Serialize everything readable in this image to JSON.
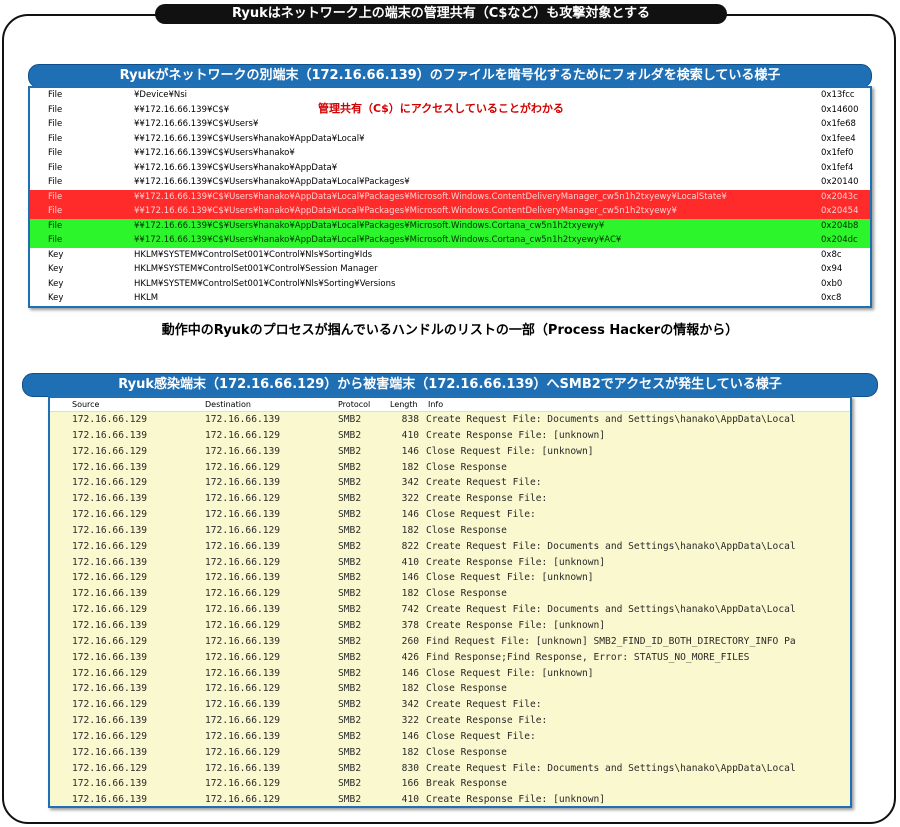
{
  "top_banner": "Ryukはネットワーク上の端末の管理共有（C$など）も攻撃対象とする",
  "section1_banner": "Ryukがネットワークの別端末（172.16.66.139）のファイルを暗号化するためにフォルダを検索している様子",
  "handle_note": "管理共有（C$）にアクセスしていることがわかる",
  "handles": [
    {
      "type": "File",
      "name": "¥Device¥Nsi",
      "handle": "0x13fcc",
      "highlight": ""
    },
    {
      "type": "File",
      "name": "¥¥172.16.66.139¥C$¥",
      "handle": "0x14600",
      "highlight": ""
    },
    {
      "type": "File",
      "name": "¥¥172.16.66.139¥C$¥Users¥",
      "handle": "0x1fe68",
      "highlight": ""
    },
    {
      "type": "File",
      "name": "¥¥172.16.66.139¥C$¥Users¥hanako¥AppData¥Local¥",
      "handle": "0x1fee4",
      "highlight": ""
    },
    {
      "type": "File",
      "name": "¥¥172.16.66.139¥C$¥Users¥hanako¥",
      "handle": "0x1fef0",
      "highlight": ""
    },
    {
      "type": "File",
      "name": "¥¥172.16.66.139¥C$¥Users¥hanako¥AppData¥",
      "handle": "0x1fef4",
      "highlight": ""
    },
    {
      "type": "File",
      "name": "¥¥172.16.66.139¥C$¥Users¥hanako¥AppData¥Local¥Packages¥",
      "handle": "0x20140",
      "highlight": ""
    },
    {
      "type": "File",
      "name": "¥¥172.16.66.139¥C$¥Users¥hanako¥AppData¥Local¥Packages¥Microsoft.Windows.ContentDeliveryManager_cw5n1h2txyewy¥LocalState¥",
      "handle": "0x2043c",
      "highlight": "red"
    },
    {
      "type": "File",
      "name": "¥¥172.16.66.139¥C$¥Users¥hanako¥AppData¥Local¥Packages¥Microsoft.Windows.ContentDeliveryManager_cw5n1h2txyewy¥",
      "handle": "0x20454",
      "highlight": "red"
    },
    {
      "type": "File",
      "name": "¥¥172.16.66.139¥C$¥Users¥hanako¥AppData¥Local¥Packages¥Microsoft.Windows.Cortana_cw5n1h2txyewy¥",
      "handle": "0x204b8",
      "highlight": "green"
    },
    {
      "type": "File",
      "name": "¥¥172.16.66.139¥C$¥Users¥hanako¥AppData¥Local¥Packages¥Microsoft.Windows.Cortana_cw5n1h2txyewy¥AC¥",
      "handle": "0x204dc",
      "highlight": "green"
    },
    {
      "type": "Key",
      "name": "HKLM¥SYSTEM¥ControlSet001¥Control¥Nls¥Sorting¥Ids",
      "handle": "0x8c",
      "highlight": ""
    },
    {
      "type": "Key",
      "name": "HKLM¥SYSTEM¥ControlSet001¥Control¥Session Manager",
      "handle": "0x94",
      "highlight": ""
    },
    {
      "type": "Key",
      "name": "HKLM¥SYSTEM¥ControlSet001¥Control¥Nls¥Sorting¥Versions",
      "handle": "0xb0",
      "highlight": ""
    },
    {
      "type": "Key",
      "name": "HKLM",
      "handle": "0xc8",
      "highlight": ""
    }
  ],
  "caption": "動作中のRyukのプロセスが掴んでいるハンドルのリストの一部（Process Hackerの情報から）",
  "section2_banner": "Ryuk感染端末（172.16.66.129）から被害端末（172.16.66.139）へSMB2でアクセスが発生している様子",
  "packet_columns": {
    "source": "Source",
    "destination": "Destination",
    "protocol": "Protocol",
    "length": "Length",
    "info": "Info"
  },
  "packets": [
    {
      "src": "172.16.66.129",
      "dst": "172.16.66.139",
      "proto": "SMB2",
      "len": "838",
      "info": "Create Request File: Documents and Settings\\hanako\\AppData\\Local"
    },
    {
      "src": "172.16.66.139",
      "dst": "172.16.66.129",
      "proto": "SMB2",
      "len": "410",
      "info": "Create Response File: [unknown]"
    },
    {
      "src": "172.16.66.129",
      "dst": "172.16.66.139",
      "proto": "SMB2",
      "len": "146",
      "info": "Close Request File: [unknown]"
    },
    {
      "src": "172.16.66.139",
      "dst": "172.16.66.129",
      "proto": "SMB2",
      "len": "182",
      "info": "Close Response"
    },
    {
      "src": "172.16.66.129",
      "dst": "172.16.66.139",
      "proto": "SMB2",
      "len": "342",
      "info": "Create Request File:"
    },
    {
      "src": "172.16.66.139",
      "dst": "172.16.66.129",
      "proto": "SMB2",
      "len": "322",
      "info": "Create Response File:"
    },
    {
      "src": "172.16.66.129",
      "dst": "172.16.66.139",
      "proto": "SMB2",
      "len": "146",
      "info": "Close Request File:"
    },
    {
      "src": "172.16.66.139",
      "dst": "172.16.66.129",
      "proto": "SMB2",
      "len": "182",
      "info": "Close Response"
    },
    {
      "src": "172.16.66.129",
      "dst": "172.16.66.139",
      "proto": "SMB2",
      "len": "822",
      "info": "Create Request File: Documents and Settings\\hanako\\AppData\\Local"
    },
    {
      "src": "172.16.66.139",
      "dst": "172.16.66.129",
      "proto": "SMB2",
      "len": "410",
      "info": "Create Response File: [unknown]"
    },
    {
      "src": "172.16.66.129",
      "dst": "172.16.66.139",
      "proto": "SMB2",
      "len": "146",
      "info": "Close Request File: [unknown]"
    },
    {
      "src": "172.16.66.139",
      "dst": "172.16.66.129",
      "proto": "SMB2",
      "len": "182",
      "info": "Close Response"
    },
    {
      "src": "172.16.66.129",
      "dst": "172.16.66.139",
      "proto": "SMB2",
      "len": "742",
      "info": "Create Request File: Documents and Settings\\hanako\\AppData\\Local"
    },
    {
      "src": "172.16.66.139",
      "dst": "172.16.66.129",
      "proto": "SMB2",
      "len": "378",
      "info": "Create Response File: [unknown]"
    },
    {
      "src": "172.16.66.129",
      "dst": "172.16.66.139",
      "proto": "SMB2",
      "len": "260",
      "info": "Find Request File: [unknown] SMB2_FIND_ID_BOTH_DIRECTORY_INFO Pa"
    },
    {
      "src": "172.16.66.139",
      "dst": "172.16.66.129",
      "proto": "SMB2",
      "len": "426",
      "info": "Find Response;Find Response, Error: STATUS_NO_MORE_FILES"
    },
    {
      "src": "172.16.66.129",
      "dst": "172.16.66.139",
      "proto": "SMB2",
      "len": "146",
      "info": "Close Request File: [unknown]"
    },
    {
      "src": "172.16.66.139",
      "dst": "172.16.66.129",
      "proto": "SMB2",
      "len": "182",
      "info": "Close Response"
    },
    {
      "src": "172.16.66.129",
      "dst": "172.16.66.139",
      "proto": "SMB2",
      "len": "342",
      "info": "Create Request File:"
    },
    {
      "src": "172.16.66.139",
      "dst": "172.16.66.129",
      "proto": "SMB2",
      "len": "322",
      "info": "Create Response File:"
    },
    {
      "src": "172.16.66.129",
      "dst": "172.16.66.139",
      "proto": "SMB2",
      "len": "146",
      "info": "Close Request File:"
    },
    {
      "src": "172.16.66.139",
      "dst": "172.16.66.129",
      "proto": "SMB2",
      "len": "182",
      "info": "Close Response"
    },
    {
      "src": "172.16.66.129",
      "dst": "172.16.66.139",
      "proto": "SMB2",
      "len": "830",
      "info": "Create Request File: Documents and Settings\\hanako\\AppData\\Local"
    },
    {
      "src": "172.16.66.139",
      "dst": "172.16.66.129",
      "proto": "SMB2",
      "len": "166",
      "info": "Break Response"
    },
    {
      "src": "172.16.66.139",
      "dst": "172.16.66.129",
      "proto": "SMB2",
      "len": "410",
      "info": "Create Response File: [unknown]"
    }
  ]
}
